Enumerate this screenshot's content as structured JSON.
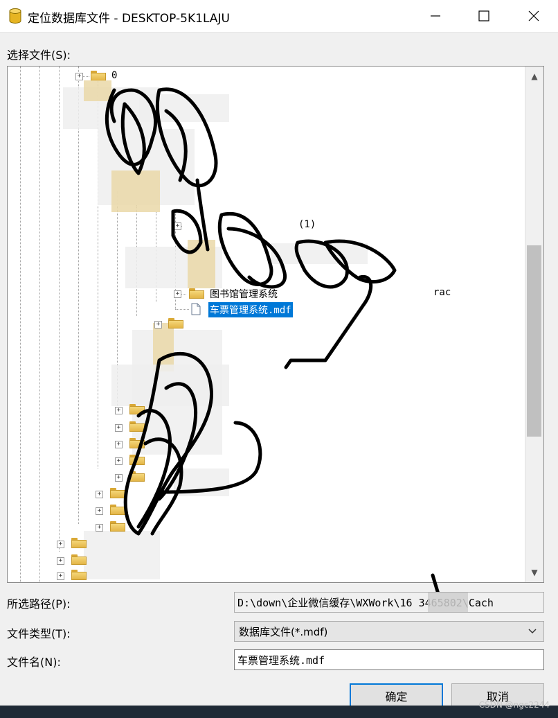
{
  "window": {
    "title": "定位数据库文件 - DESKTOP-5K1LAJU",
    "minimize_label": "—",
    "maximize_label": "☐",
    "close_label": "✕"
  },
  "select_file_label": "选择文件(S):",
  "tree": {
    "items": [
      {
        "label": "0",
        "expanded": false
      },
      {
        "label": "(1)",
        "expanded": false
      },
      {
        "label": "rac",
        "expanded": false
      },
      {
        "label": "图书馆管理系统",
        "expanded": false
      },
      {
        "label": "车票管理系统.mdf",
        "selected": true
      }
    ]
  },
  "path": {
    "label": "所选路径(P):",
    "value": "D:\\down\\企业微信缓存\\WXWork\\16        3465802\\Cach"
  },
  "filetype": {
    "label": "文件类型(T):",
    "value": "数据库文件(*.mdf)"
  },
  "filename": {
    "label": "文件名(N):",
    "value": "车票管理系统.mdf"
  },
  "buttons": {
    "ok": "确定",
    "cancel": "取消"
  },
  "watermark": "CSDN @ngc2244",
  "colors": {
    "selection": "#0078d7",
    "folder": "#f5d77a"
  }
}
